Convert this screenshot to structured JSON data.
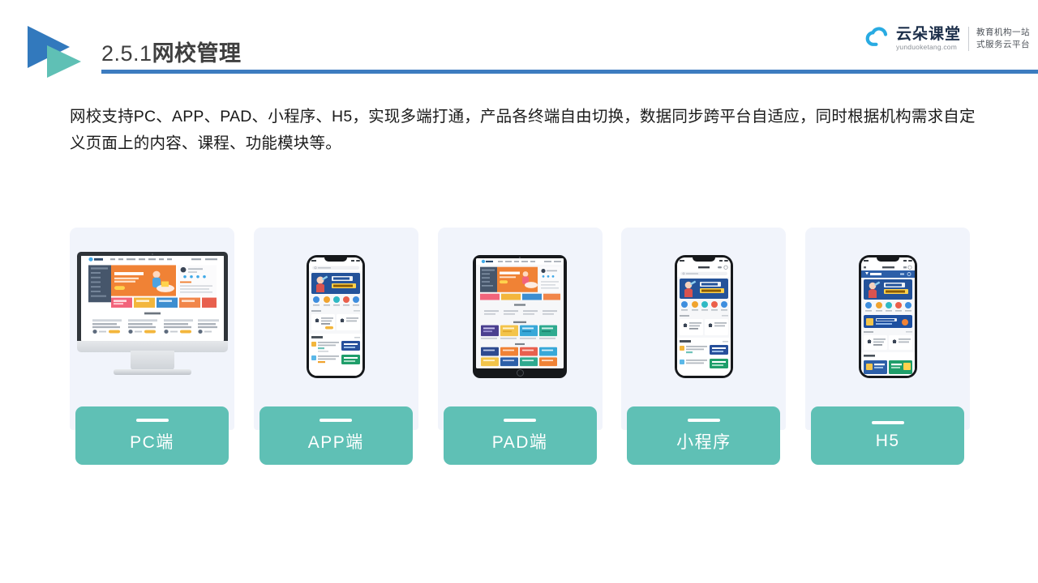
{
  "slide": {
    "heading_number": "2.5.1",
    "heading_title": "网校管理",
    "accent_blue": "#3d7cc0",
    "accent_teal": "#5fc0b5",
    "card_bg": "#f1f4fb",
    "body_paragraph": "网校支持PC、APP、PAD、小程序、H5，实现多端打通，产品各终端自由切换，数据同步跨平台自适应，同时根据机构需求自定义页面上的内容、课程、功能模块等。"
  },
  "brand": {
    "name_cn": "云朵课堂",
    "name_en": "yunduoketang.com",
    "tagline_line1": "教育机构一站",
    "tagline_line2": "式服务云平台",
    "cloud_color": "#29abe2"
  },
  "devices": [
    {
      "id": "pc",
      "label": "PC端",
      "device_type": "imac"
    },
    {
      "id": "app",
      "label": "APP端",
      "device_type": "phone"
    },
    {
      "id": "pad",
      "label": "PAD端",
      "device_type": "tablet"
    },
    {
      "id": "mini",
      "label": "小程序",
      "device_type": "phone"
    },
    {
      "id": "h5",
      "label": "H5",
      "device_type": "phone"
    }
  ]
}
